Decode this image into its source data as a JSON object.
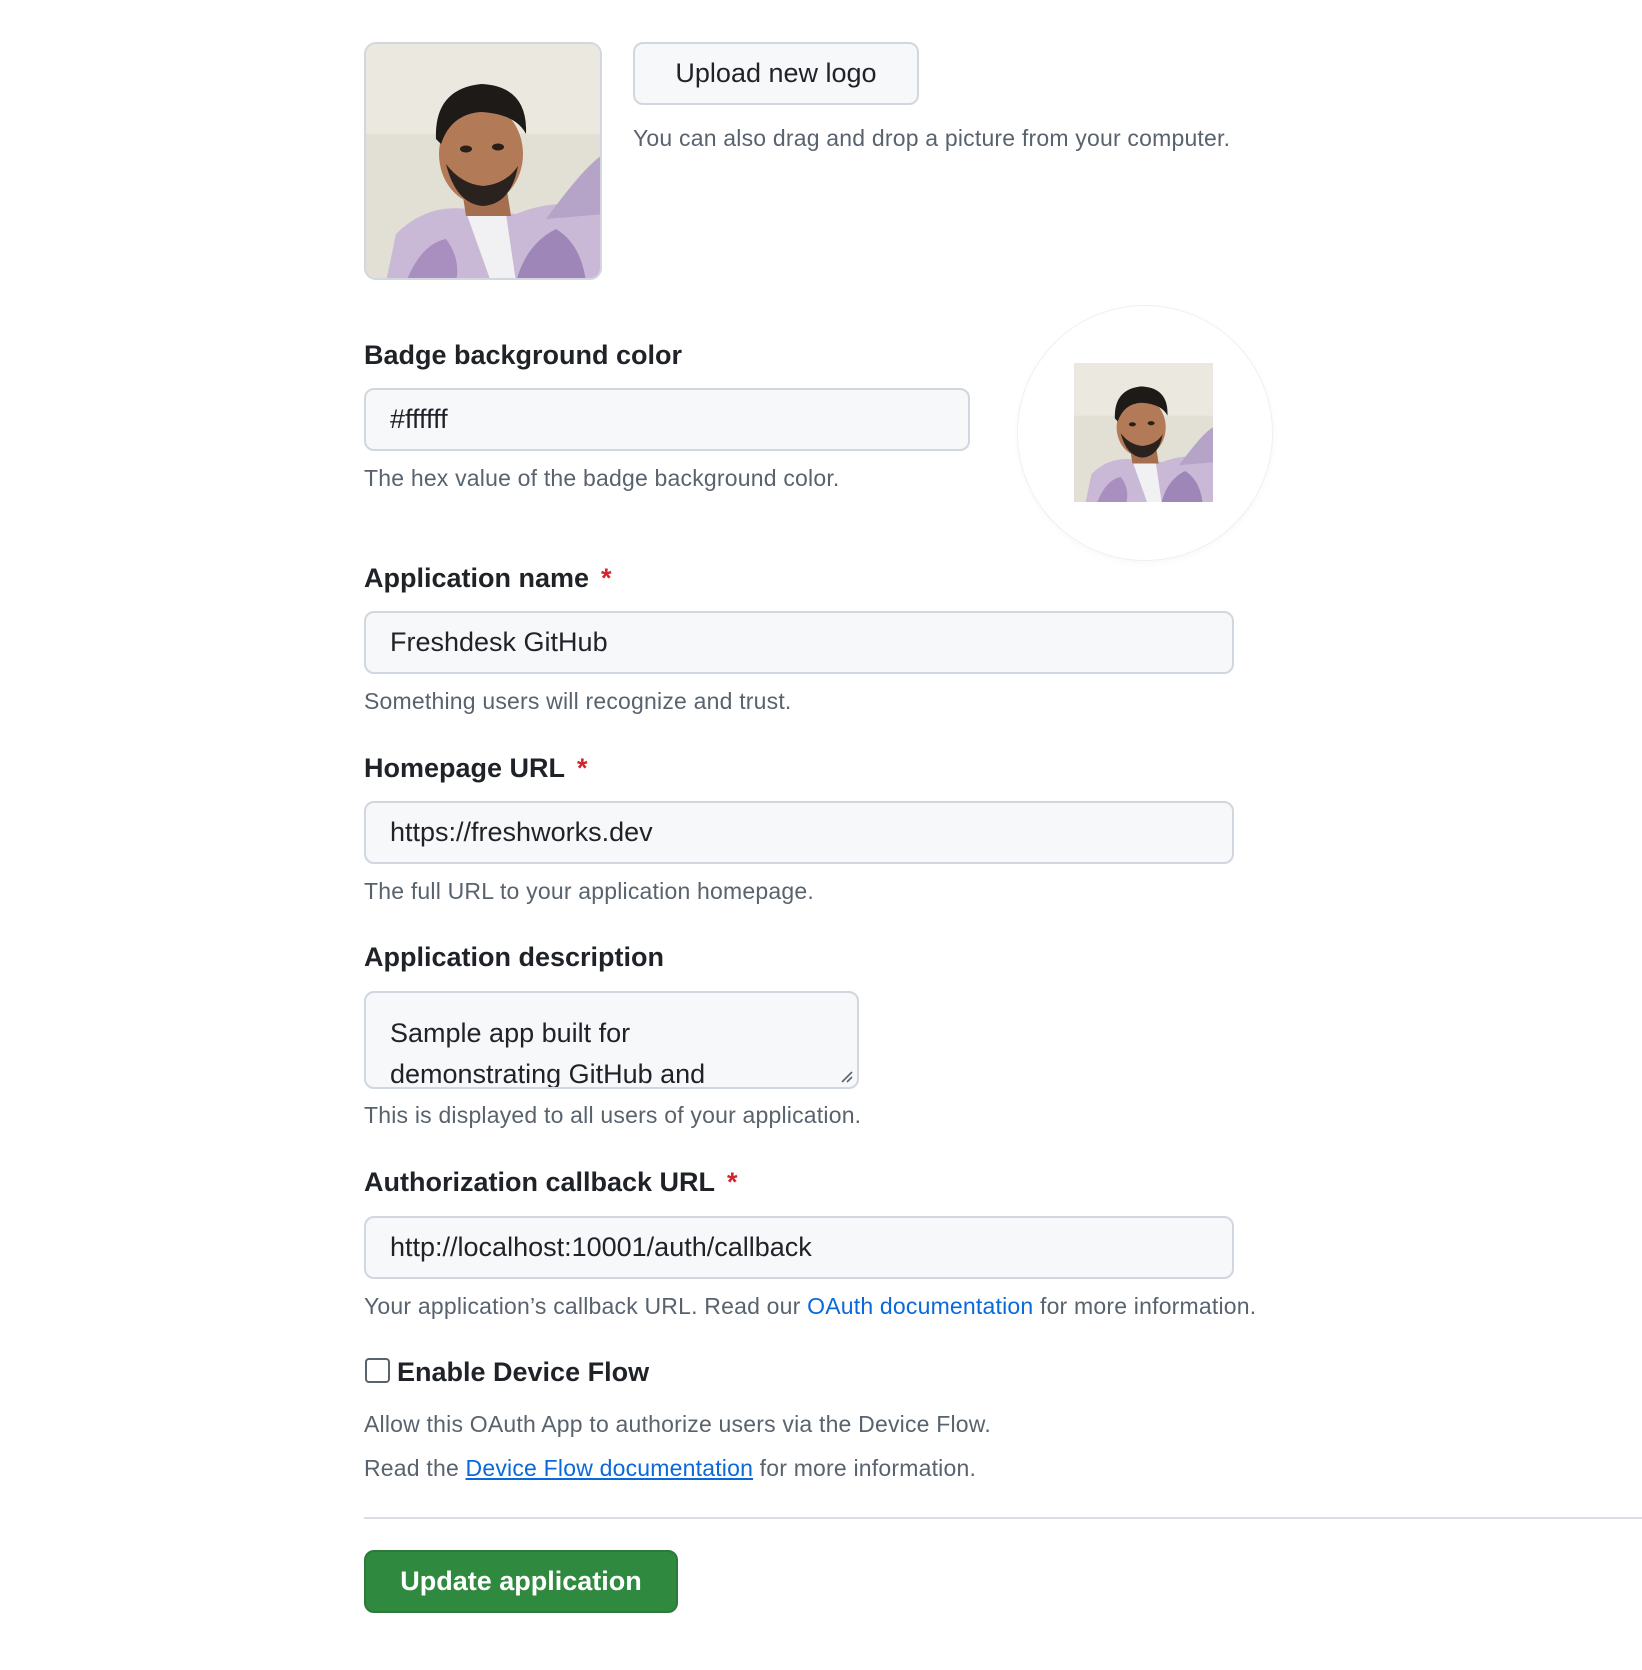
{
  "logo": {
    "upload_label": "Upload new logo",
    "drag_hint": "You can also drag and drop a picture from your computer."
  },
  "badge": {
    "label": "Badge background color",
    "value": "#ffffff",
    "hint": "The hex value of the badge background color."
  },
  "app_name": {
    "label": "Application name",
    "required_mark": "*",
    "value": "Freshdesk GitHub",
    "hint": "Something users will recognize and trust."
  },
  "homepage": {
    "label": "Homepage URL",
    "required_mark": "*",
    "value": "https://freshworks.dev",
    "hint": "The full URL to your application homepage."
  },
  "description": {
    "label": "Application description",
    "value_line1": "Sample app built for",
    "value_line2": "demonstrating GitHub and",
    "hint": "This is displayed to all users of your application."
  },
  "callback": {
    "label": "Authorization callback URL",
    "required_mark": "*",
    "value": "http://localhost:10001/auth/callback",
    "hint_prefix": "Your application’s callback URL. Read our ",
    "hint_link": "OAuth documentation",
    "hint_suffix": " for more information."
  },
  "device_flow": {
    "label": "Enable Device Flow",
    "checked": false,
    "hint": "Allow this OAuth App to authorize users via the Device Flow.",
    "read_prefix": "Read the ",
    "read_link": "Device Flow documentation",
    "read_suffix": " for more information."
  },
  "submit": {
    "label": "Update application"
  },
  "colors": {
    "primary_button": "#2f8a3f",
    "link": "#0969da",
    "required": "#d1242f"
  }
}
